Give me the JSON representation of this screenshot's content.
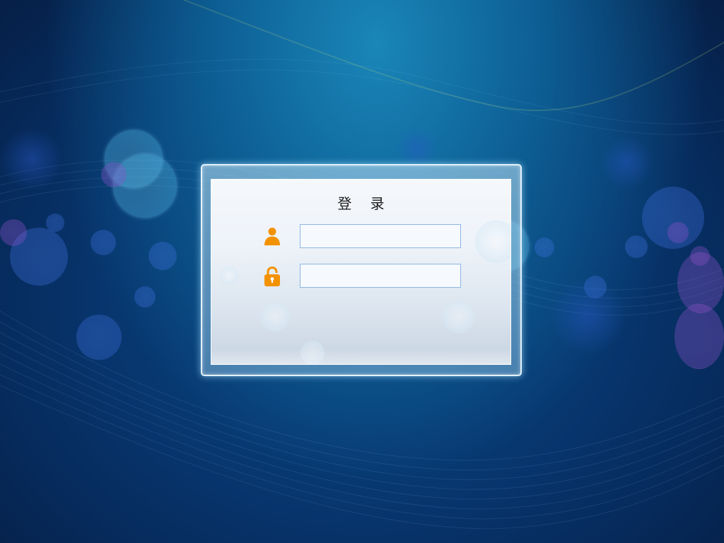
{
  "login": {
    "title": "登 录",
    "username": {
      "icon": "user-icon",
      "value": "",
      "placeholder": ""
    },
    "password": {
      "icon": "lock-icon",
      "value": "",
      "placeholder": ""
    }
  },
  "colors": {
    "icon_accent": "#f39200",
    "input_border": "#8db6e2",
    "background_dark": "#062450",
    "background_glow": "#1a86b8"
  }
}
